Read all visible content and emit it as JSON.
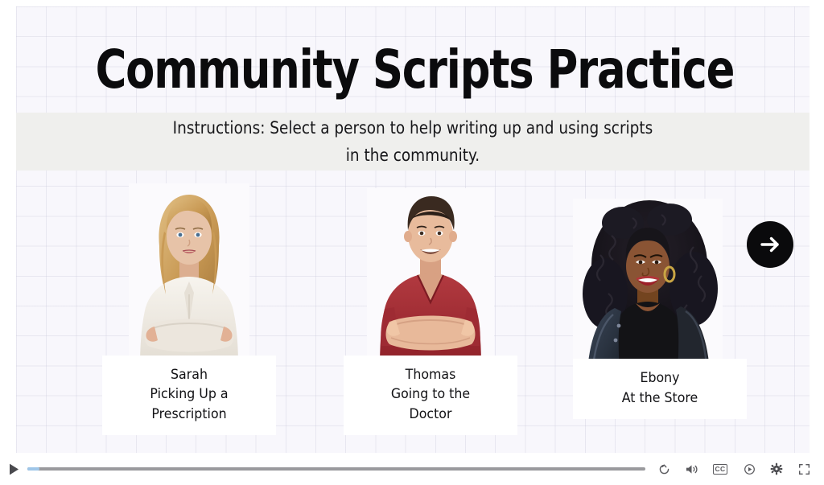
{
  "slide": {
    "title": "Community Scripts Practice",
    "instructions": "Instructions: Select a person to help writing up and using scripts\nin the community.",
    "background_color": "#f8f7fc",
    "band_color": "#efefed",
    "grid_line_color": "#c1c1d6"
  },
  "cards": [
    {
      "name": "Sarah",
      "task": "Picking Up a\nPrescription",
      "label": "Sarah\nPicking Up a\nPrescription",
      "photo_alt": "Blonde woman in a cream henley top with arms crossed",
      "photo": {
        "skin": "#e7c3a8",
        "hair": "#c99a55",
        "clothing": "#efeae2"
      }
    },
    {
      "name": "Thomas",
      "task": "Going to the\nDoctor",
      "label": "Thomas\nGoing to the\nDoctor",
      "photo_alt": "Young man with dark hair in a red v-neck t-shirt with arms crossed",
      "photo": {
        "skin": "#e8bb9c",
        "hair": "#3a2a20",
        "clothing": "#a62c35"
      }
    },
    {
      "name": "Ebony",
      "task": "At the Store",
      "label": "Ebony\nAt the Store",
      "photo_alt": "Woman with long curly black hair in a denim and leather jacket over a black top",
      "photo": {
        "skin": "#8a5434",
        "hair": "#17151a",
        "clothing": "#2d3646"
      }
    }
  ],
  "next_button": {
    "icon": "arrow-right-icon",
    "label": "Next",
    "color": "#0a0a0c"
  },
  "player": {
    "play_label": "Play",
    "play_icon": "play-icon",
    "progress_percent": 2,
    "controls": [
      {
        "icon": "replay-icon",
        "label": "Replay"
      },
      {
        "icon": "volume-icon",
        "label": "Volume"
      },
      {
        "icon": "closed-captions-icon",
        "label": "CC"
      },
      {
        "icon": "playback-speed-icon",
        "label": "Playback Speed"
      },
      {
        "icon": "gear-icon",
        "label": "Settings"
      },
      {
        "icon": "fullscreen-icon",
        "label": "Fullscreen"
      }
    ]
  }
}
